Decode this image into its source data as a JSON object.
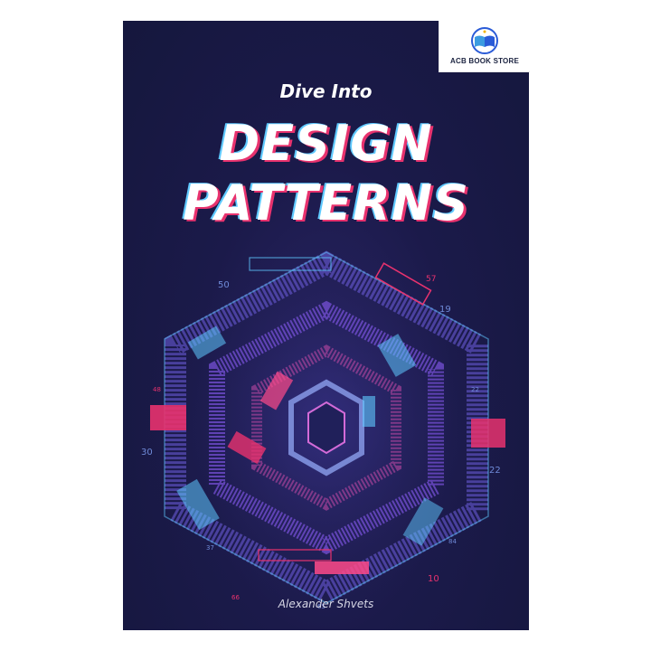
{
  "store_badge": {
    "name": "ACB BOOK STORE",
    "icon": "open-book-logo-icon"
  },
  "cover": {
    "subtitle": "Dive Into",
    "title_line1": "DESIGN",
    "title_line2": "PATTERNS",
    "author": "Alexander Shvets",
    "colors": {
      "background": "#1b1a4a",
      "accent_pink": "#e8326e",
      "accent_blue": "#5fc9ff",
      "accent_violet": "#8a5cf5"
    },
    "art_numbers": [
      "50",
      "57",
      "19",
      "48",
      "30",
      "22",
      "22",
      "84",
      "10",
      "66",
      "65",
      "37"
    ]
  }
}
